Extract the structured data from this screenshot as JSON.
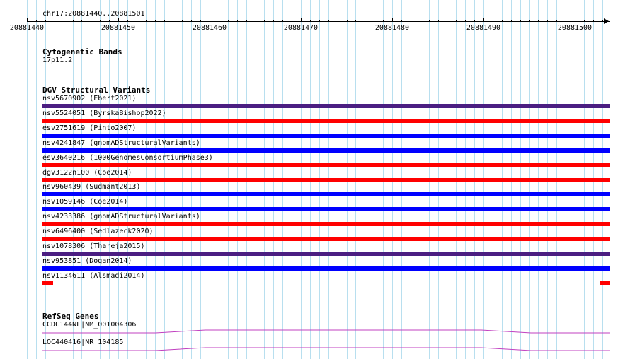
{
  "ruler": {
    "title": "chr17:20881440..20881501",
    "ticks": [
      "20881440",
      "20881450",
      "20881460",
      "20881470",
      "20881480",
      "20881490",
      "20881500"
    ]
  },
  "cytoband": {
    "title": "Cytogenetic Bands",
    "band": "17p11.2"
  },
  "dgv": {
    "title": "DGV Structural Variants",
    "variants": [
      {
        "label": "nsv5670902 (Ebert2021)",
        "color": "#4b1e82"
      },
      {
        "label": "nsv5524051 (ByrskaBishop2022)",
        "color": "#ff0000"
      },
      {
        "label": "esv2751619 (Pinto2007)",
        "color": "#0000ff"
      },
      {
        "label": "nsv4241847 (gnomADStructuralVariants)",
        "color": "#0000ff"
      },
      {
        "label": "esv3640216 (1000GenomesConsortiumPhase3)",
        "color": "#ff0000"
      },
      {
        "label": "dgv3122n100 (Coe2014)",
        "color": "#ff0000"
      },
      {
        "label": "nsv960439 (Sudmant2013)",
        "color": "#0000ff"
      },
      {
        "label": "nsv1059146 (Coe2014)",
        "color": "#0000ff"
      },
      {
        "label": "nsv4233386 (gnomADStructuralVariants)",
        "color": "#ff0000"
      },
      {
        "label": "nsv6496400 (Sedlazeck2020)",
        "color": "#ff0000"
      },
      {
        "label": "nsv1078306 (Thareja2015)",
        "color": "#4b1e82"
      },
      {
        "label": "nsv953851 (Dogan2014)",
        "color": "#0000ff"
      },
      {
        "label": "nsv1134611 (Alsmadi2014)",
        "color": "#ff0000"
      }
    ]
  },
  "refseq": {
    "title": "RefSeq Genes",
    "genes": [
      {
        "label": "CCDC144NL|NM_001004306",
        "color": "#c040c0"
      },
      {
        "label": "LOC440416|NR_104185",
        "color": "#c040c0"
      }
    ]
  }
}
